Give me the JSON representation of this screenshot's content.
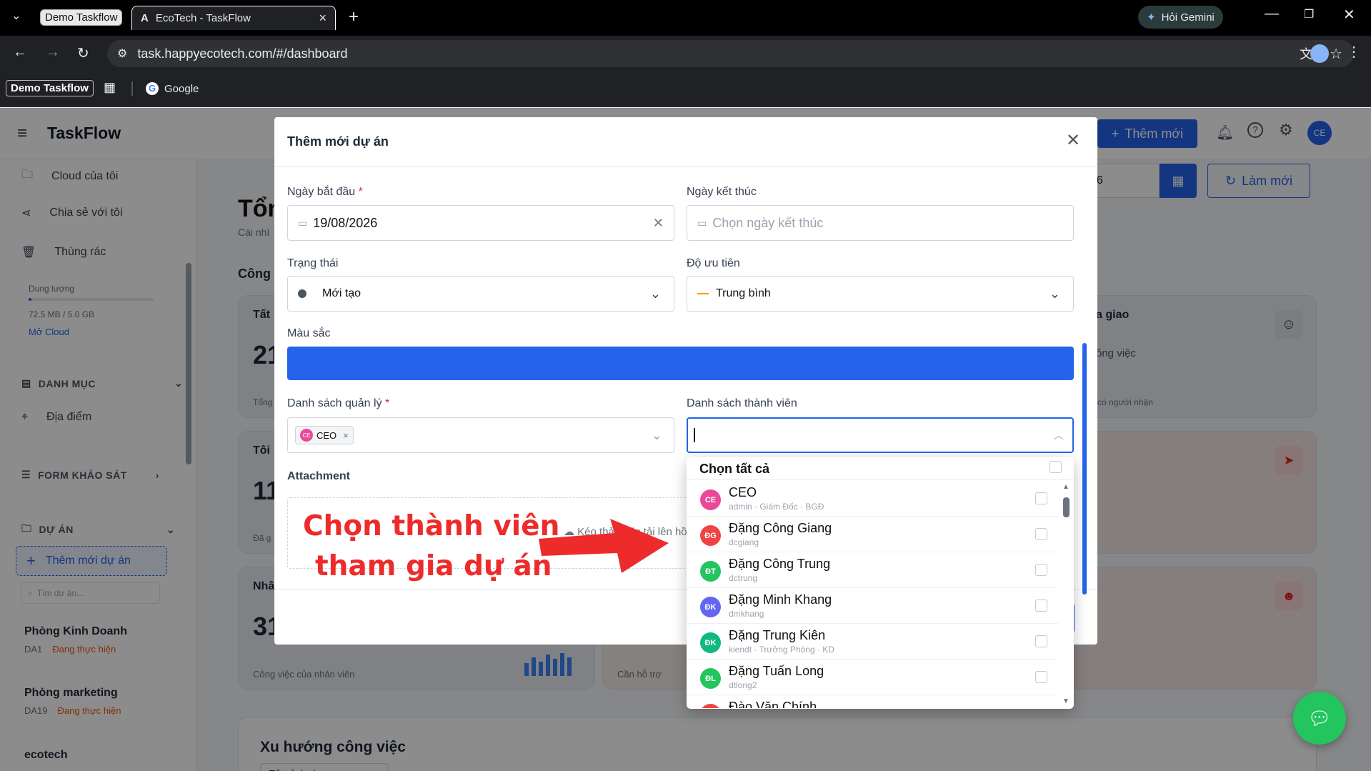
{
  "browser": {
    "tab_group": "Demo Taskflow",
    "tab_title": "EcoTech - TaskFlow",
    "gemini": "Hỏi Gemini",
    "url": "task.happyecotech.com/#/dashboard",
    "bookmark_group": "Demo Taskflow",
    "bookmark_google": "Google"
  },
  "app": {
    "title": "TaskFlow",
    "add_new": "Thêm mới",
    "avatar": "CE",
    "accent": "#2563eb",
    "refresh": "Làm mới",
    "date_partial": "26"
  },
  "sidebar": {
    "cloud": "Cloud của tôi",
    "shared": "Chia sẻ với tôi",
    "trash": "Thùng rác",
    "storage_label": "Dung lượng",
    "storage_value": "72.5 MB / 5.0 GB",
    "storage_fraction": 0.0145,
    "open_cloud": "Mở Cloud",
    "category": "DANH MỤC",
    "location": "Địa điểm",
    "survey": "FORM KHẢO SÁT",
    "projects": "DỰ ÁN",
    "add_project": "Thêm mới dự án",
    "search_ph": "Tìm dự án...",
    "items": [
      {
        "name": "Phòng Kinh Doanh",
        "code": "DA1",
        "status": "Đang thực hiện"
      },
      {
        "name": "Phòng marketing",
        "code": "DA19",
        "status": "Đang thực hiện"
      },
      {
        "name": "ecotech"
      }
    ]
  },
  "dashboard": {
    "title_partial": "Tổn",
    "subtitle_partial": "Cái nhì",
    "section_partial": "Công",
    "card1_title": "Tất",
    "card1_num": "21",
    "card1_foot": "Tổng",
    "card2_title": "Tôi",
    "card2_num": "11",
    "card2_foot": "Đã g",
    "card3_title": "Nhâ",
    "card3_num": "31",
    "card3_foot": "Công việc của nhân viên",
    "card4_foot": "Cần hỗ trợ",
    "right1_title": "a giao",
    "right1_sub": "ông việc",
    "right1_foot": "có người nhận",
    "trend_title": "Xu hướng công việc",
    "trend_filter": "Tất cả dự án"
  },
  "modal": {
    "title": "Thêm mới dự án",
    "start_label": "Ngày bắt đầu",
    "start_value": "19/08/2026",
    "end_label": "Ngày kết thúc",
    "end_ph": "Chọn ngày kết thúc",
    "status_label": "Trạng thái",
    "status_value": "Mới tạo",
    "priority_label": "Độ ưu tiên",
    "priority_value": "Trung bình",
    "color_label": "Màu sắc",
    "color_value": "#2563eb",
    "managers_label": "Danh sách quản lý",
    "manager_tag": "CEO",
    "members_label": "Danh sách thành viên",
    "attachment_label": "Attachment",
    "drop_text": "Kéo thả",
    "drop_text2": "hoặc tải lên hồ"
  },
  "dropdown": {
    "select_all": "Chọn tất cả",
    "options": [
      {
        "initials": "CE",
        "name": "CEO",
        "sub": "admin · Giám Đốc · BGĐ",
        "color": "#ec4899"
      },
      {
        "initials": "ĐG",
        "name": "Đặng Công Giang",
        "sub": "dcgiang",
        "color": "#ef4444"
      },
      {
        "initials": "ĐT",
        "name": "Đặng Công Trung",
        "sub": "dctrung",
        "color": "#22c55e"
      },
      {
        "initials": "ĐK",
        "name": "Đặng Minh Khang",
        "sub": "dmkhang",
        "color": "#6366f1"
      },
      {
        "initials": "ĐK",
        "name": "Đặng Trung Kiên",
        "sub": "kiendt · Trưởng Phòng · KD",
        "color": "#10b981"
      },
      {
        "initials": "ĐL",
        "name": "Đặng Tuấn Long",
        "sub": "dtlong2",
        "color": "#22c55e"
      },
      {
        "initials": "",
        "name": "Đào Văn Chính",
        "sub": "",
        "color": "#ef4444"
      }
    ]
  },
  "annotation": {
    "line1": "Chọn thành viên",
    "line2": "tham gia dự án"
  }
}
